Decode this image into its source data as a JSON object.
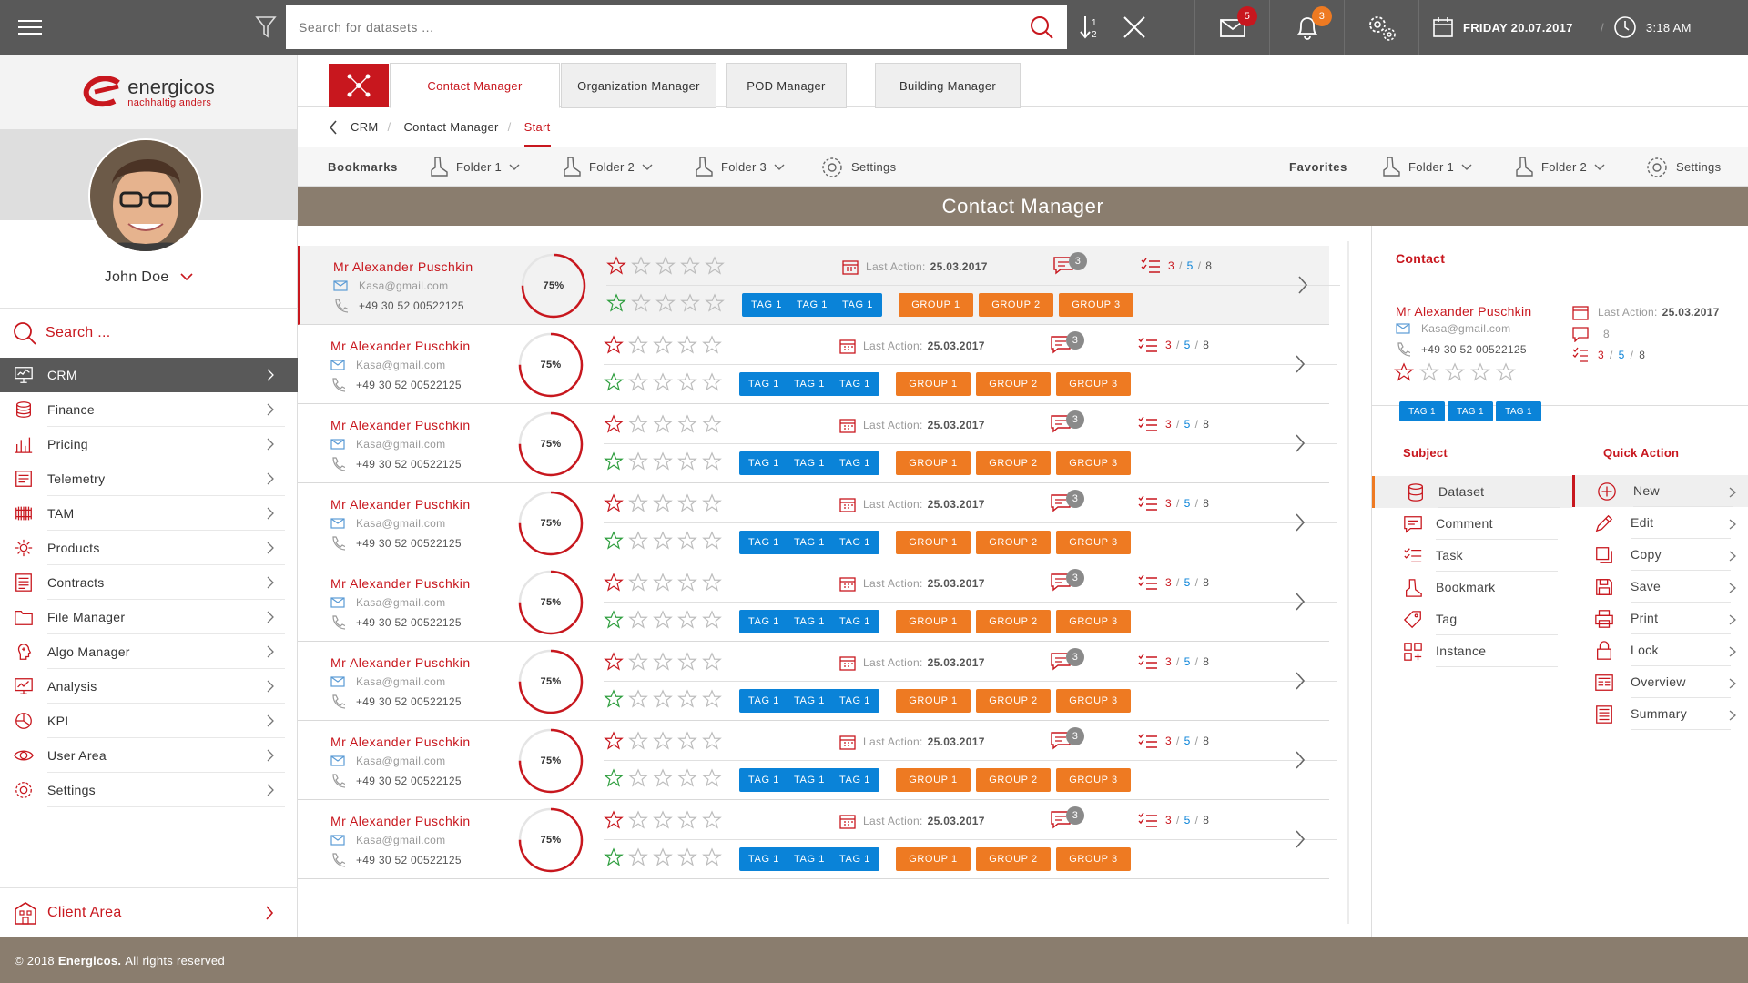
{
  "topbar": {
    "search_placeholder": "Search for datasets ...",
    "mail_count": "5",
    "notification_count": "3",
    "date": "FRIDAY 20.07.2017",
    "time": "3:18 AM",
    "colors": {
      "bar": "#595959",
      "mail_badge": "#c8171e",
      "notification_badge": "#ee7a22"
    }
  },
  "brand": {
    "name": "energicos",
    "tagline": "nachhaltig anders",
    "color": "#c8171e"
  },
  "user": {
    "name": "John Doe"
  },
  "sidebar": {
    "search_placeholder": "Search ...",
    "items": [
      {
        "label": "CRM",
        "icon": "monitor-icon"
      },
      {
        "label": "Finance",
        "icon": "coins-icon"
      },
      {
        "label": "Pricing",
        "icon": "chart-icon"
      },
      {
        "label": "Telemetry",
        "icon": "telemetry-icon"
      },
      {
        "label": "TAM",
        "icon": "radiator-icon"
      },
      {
        "label": "Products",
        "icon": "products-icon"
      },
      {
        "label": "Contracts",
        "icon": "contracts-icon"
      },
      {
        "label": "File Manager",
        "icon": "folder-icon"
      },
      {
        "label": "Algo Manager",
        "icon": "brain-icon"
      },
      {
        "label": "Analysis",
        "icon": "analysis-icon"
      },
      {
        "label": "KPI",
        "icon": "kpi-icon"
      },
      {
        "label": "User Area",
        "icon": "eye-icon"
      },
      {
        "label": "Settings",
        "icon": "gear-icon"
      }
    ],
    "client_area": "Client Area"
  },
  "tabs": [
    "Contact Manager",
    "Organization Manager",
    "POD Manager",
    "Building Manager"
  ],
  "breadcrumb": [
    "CRM",
    "Contact Manager",
    "Start"
  ],
  "bookmarks": {
    "label": "Bookmarks",
    "folders": [
      "Folder 1",
      "Folder 2",
      "Folder 3"
    ],
    "settings": "Settings",
    "favorites_label": "Favorites",
    "fav_folders": [
      "Folder 1",
      "Folder 2"
    ],
    "fav_settings": "Settings"
  },
  "page_title": "Contact Manager",
  "contacts_common": {
    "last_action_label": "Last Action:",
    "comment_count": "3",
    "tasks_a": "3",
    "tasks_b": "5",
    "tasks_c": "8",
    "tag_label": "TAG 1",
    "groups": [
      "GROUP 1",
      "GROUP 2",
      "GROUP 3"
    ],
    "colors": {
      "tag": "#0a83d8",
      "group": "#ee7a22",
      "star_red": "#c8171e",
      "star_green": "#2e9e3e"
    }
  },
  "contacts": [
    {
      "name": "Mr Alexander Puschkin",
      "email": "Kasa@gmail.com",
      "phone": "+49 30 52 00522125",
      "progress": "75%",
      "progress_value": 0.75,
      "last_action": "25.03.2017"
    },
    {
      "name": "Mr Alexander Puschkin",
      "email": "Kasa@gmail.com",
      "phone": "+49 30 52 00522125",
      "progress": "75%",
      "progress_value": 0.75,
      "last_action": "25.03.2017"
    },
    {
      "name": "Mr Alexander Puschkin",
      "email": "Kasa@gmail.com",
      "phone": "+49 30 52 00522125",
      "progress": "75%",
      "progress_value": 0.75,
      "last_action": "25.03.2017"
    },
    {
      "name": "Mr Alexander Puschkin",
      "email": "Kasa@gmail.com",
      "phone": "+49 30 52 00522125",
      "progress": "75%",
      "progress_value": 0.75,
      "last_action": "25.03.2017"
    },
    {
      "name": "Mr Alexander Puschkin",
      "email": "Kasa@gmail.com",
      "phone": "+49 30 52 00522125",
      "progress": "75%",
      "progress_value": 0.75,
      "last_action": "25.03.2017"
    },
    {
      "name": "Mr Alexander Puschkin",
      "email": "Kasa@gmail.com",
      "phone": "+49 30 52 00522125",
      "progress": "75%",
      "progress_value": 0.75,
      "last_action": "25.03.2017"
    },
    {
      "name": "Mr Alexander Puschkin",
      "email": "Kasa@gmail.com",
      "phone": "+49 30 52 00522125",
      "progress": "75%",
      "progress_value": 0.75,
      "last_action": "25.03.2017"
    },
    {
      "name": "Mr Alexander Puschkin",
      "email": "Kasa@gmail.com",
      "phone": "+49 30 52 00522125",
      "progress": "75%",
      "progress_value": 0.75,
      "last_action": "25.03.2017"
    }
  ],
  "detail": {
    "title": "Contact",
    "name": "Mr Alexander Puschkin",
    "email": "Kasa@gmail.com",
    "phone": "+49 30 52 00522125",
    "last_action_label": "Last Action:",
    "last_action": "25.03.2017",
    "comments": "8",
    "tasks_a": "3",
    "tasks_b": "5",
    "tasks_c": "8",
    "tags": [
      "TAG 1",
      "TAG 1",
      "TAG 1"
    ],
    "subject_label": "Subject",
    "quick_action_label": "Quick Action",
    "subjects": [
      "Dataset",
      "Comment",
      "Task",
      "Bookmark",
      "Tag",
      "Instance"
    ],
    "quick_actions": [
      "New",
      "Edit",
      "Copy",
      "Save",
      "Print",
      "Lock",
      "Overview",
      "Summary"
    ]
  },
  "footer": {
    "copyright": "© 2018",
    "company": "Energicos.",
    "rights": "All rights reserved"
  }
}
